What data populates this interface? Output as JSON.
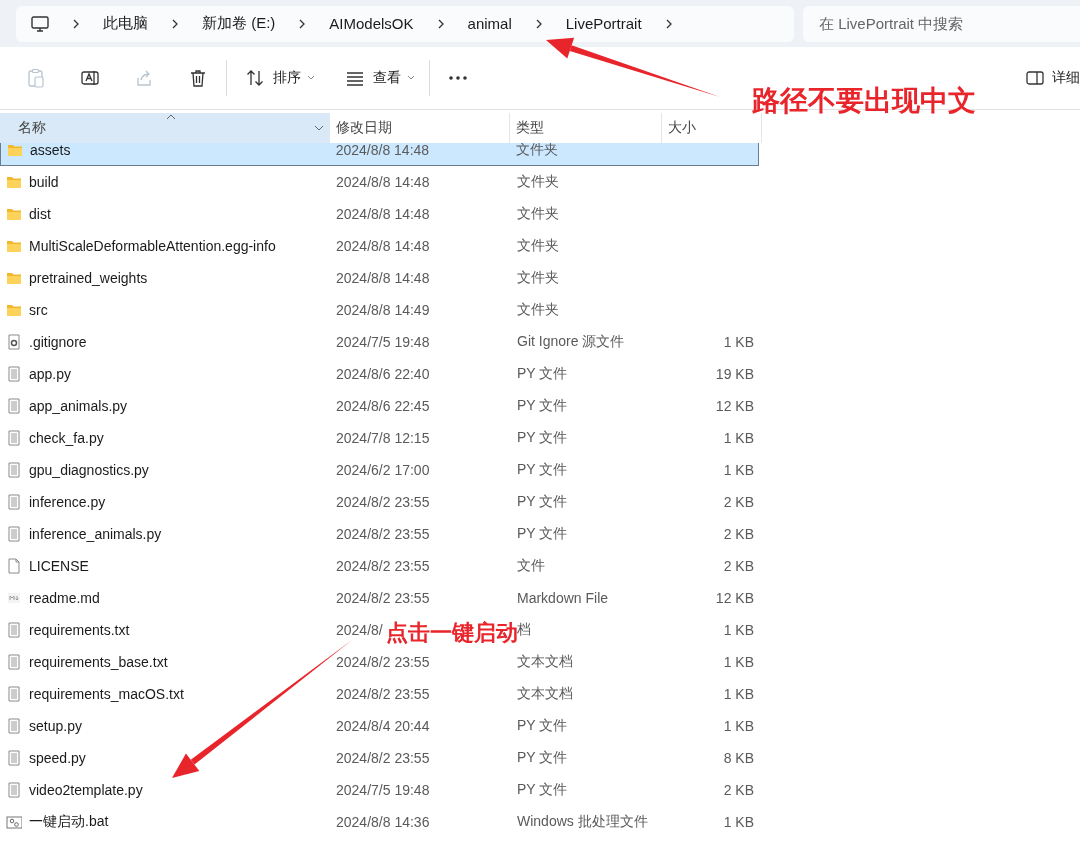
{
  "address_bar": {
    "segments": [
      "此电脑",
      "新加卷 (E:)",
      "AIModelsOK",
      "animal",
      "LivePortrait"
    ]
  },
  "search": {
    "placeholder": "在 LivePortrait 中搜索"
  },
  "toolbar": {
    "buttons": [
      {
        "kind": "paste",
        "disabled": true
      },
      {
        "kind": "rename",
        "disabled": false
      },
      {
        "kind": "share",
        "disabled": true
      },
      {
        "kind": "delete",
        "disabled": false
      },
      {
        "kind": "sort",
        "label": "排序",
        "disabled": false
      },
      {
        "kind": "view",
        "label": "查看",
        "disabled": false
      },
      {
        "kind": "more",
        "disabled": false
      }
    ],
    "details": {
      "label": "详细"
    }
  },
  "columns": [
    {
      "label": "名称",
      "sorted": true
    },
    {
      "label": "修改日期",
      "sorted": false
    },
    {
      "label": "类型",
      "sorted": false
    },
    {
      "label": "大小",
      "sorted": false
    }
  ],
  "rows": [
    {
      "kind": "folder",
      "name": "assets",
      "date": "2024/8/8 14:48",
      "type": "文件夹",
      "selected": true
    },
    {
      "kind": "folder",
      "name": "build",
      "date": "2024/8/8 14:48",
      "type": "文件夹",
      "selected": false
    },
    {
      "kind": "folder",
      "name": "dist",
      "date": "2024/8/8 14:48",
      "type": "文件夹",
      "selected": false
    },
    {
      "kind": "folder",
      "name": "MultiScaleDeformableAttention.egg-info",
      "date": "2024/8/8 14:48",
      "type": "文件夹",
      "selected": false
    },
    {
      "kind": "folder",
      "name": "pretrained_weights",
      "date": "2024/8/8 14:48",
      "type": "文件夹",
      "selected": false
    },
    {
      "kind": "folder",
      "name": "src",
      "date": "2024/8/8 14:49",
      "type": "文件夹",
      "selected": false
    },
    {
      "kind": "config",
      "name": ".gitignore",
      "date": "2024/7/5 19:48",
      "type": "Git Ignore 源文件",
      "size": "1 KB",
      "selected": false
    },
    {
      "kind": "text",
      "name": "app.py",
      "date": "2024/8/6 22:40",
      "type": "PY 文件",
      "size": "19 KB",
      "selected": false
    },
    {
      "kind": "text",
      "name": "app_animals.py",
      "date": "2024/8/6 22:45",
      "type": "PY 文件",
      "size": "12 KB",
      "selected": false
    },
    {
      "kind": "text",
      "name": "check_fa.py",
      "date": "2024/7/8 12:15",
      "type": "PY 文件",
      "size": "1 KB",
      "selected": false
    },
    {
      "kind": "text",
      "name": "gpu_diagnostics.py",
      "date": "2024/6/2 17:00",
      "type": "PY 文件",
      "size": "1 KB",
      "selected": false
    },
    {
      "kind": "text",
      "name": "inference.py",
      "date": "2024/8/2 23:55",
      "type": "PY 文件",
      "size": "2 KB",
      "selected": false
    },
    {
      "kind": "text",
      "name": "inference_animals.py",
      "date": "2024/8/2 23:55",
      "type": "PY 文件",
      "size": "2 KB",
      "selected": false
    },
    {
      "kind": "blank",
      "name": "LICENSE",
      "date": "2024/8/2 23:55",
      "type": "文件",
      "size": "2 KB",
      "selected": false
    },
    {
      "kind": "markdown",
      "name": "readme.md",
      "date": "2024/8/2 23:55",
      "type": "Markdown File",
      "size": "12 KB",
      "selected": false
    },
    {
      "kind": "text",
      "name": "requirements.txt",
      "date": "2024/8/",
      "type": "档",
      "size": "1 KB",
      "selected": false,
      "note": "点击一键启动"
    },
    {
      "kind": "text",
      "name": "requirements_base.txt",
      "date": "2024/8/2 23:55",
      "type": "文本文档",
      "size": "1 KB",
      "selected": false
    },
    {
      "kind": "text",
      "name": "requirements_macOS.txt",
      "date": "2024/8/2 23:55",
      "type": "文本文档",
      "size": "1 KB",
      "selected": false
    },
    {
      "kind": "text",
      "name": "setup.py",
      "date": "2024/8/4 20:44",
      "type": "PY 文件",
      "size": "1 KB",
      "selected": false
    },
    {
      "kind": "text",
      "name": "speed.py",
      "date": "2024/8/2 23:55",
      "type": "PY 文件",
      "size": "8 KB",
      "selected": false
    },
    {
      "kind": "text",
      "name": "video2template.py",
      "date": "2024/7/5 19:48",
      "type": "PY 文件",
      "size": "2 KB",
      "selected": false
    },
    {
      "kind": "batch",
      "name": "一键启动.bat",
      "date": "2024/8/8 14:36",
      "type": "Windows 批处理文件",
      "size": "1 KB",
      "selected": false
    }
  ],
  "annotations": [
    {
      "text": "路径不要出现中文"
    }
  ]
}
